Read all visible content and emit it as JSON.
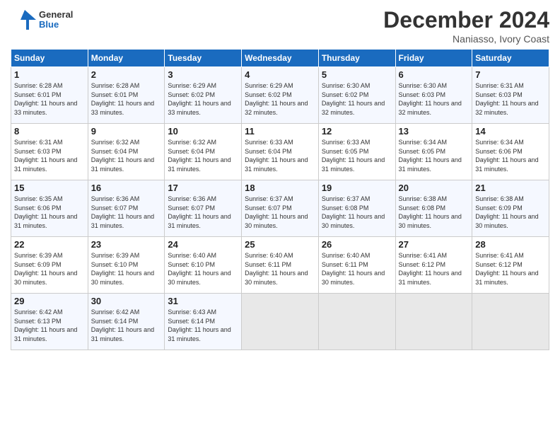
{
  "logo": {
    "text_general": "General",
    "text_blue": "Blue"
  },
  "title": "December 2024",
  "subtitle": "Naniasso, Ivory Coast",
  "headers": [
    "Sunday",
    "Monday",
    "Tuesday",
    "Wednesday",
    "Thursday",
    "Friday",
    "Saturday"
  ],
  "weeks": [
    [
      {
        "day": "1",
        "sunrise": "6:28 AM",
        "sunset": "6:01 PM",
        "daylight": "11 hours and 33 minutes."
      },
      {
        "day": "2",
        "sunrise": "6:28 AM",
        "sunset": "6:01 PM",
        "daylight": "11 hours and 33 minutes."
      },
      {
        "day": "3",
        "sunrise": "6:29 AM",
        "sunset": "6:02 PM",
        "daylight": "11 hours and 33 minutes."
      },
      {
        "day": "4",
        "sunrise": "6:29 AM",
        "sunset": "6:02 PM",
        "daylight": "11 hours and 32 minutes."
      },
      {
        "day": "5",
        "sunrise": "6:30 AM",
        "sunset": "6:02 PM",
        "daylight": "11 hours and 32 minutes."
      },
      {
        "day": "6",
        "sunrise": "6:30 AM",
        "sunset": "6:03 PM",
        "daylight": "11 hours and 32 minutes."
      },
      {
        "day": "7",
        "sunrise": "6:31 AM",
        "sunset": "6:03 PM",
        "daylight": "11 hours and 32 minutes."
      }
    ],
    [
      {
        "day": "8",
        "sunrise": "6:31 AM",
        "sunset": "6:03 PM",
        "daylight": "11 hours and 31 minutes."
      },
      {
        "day": "9",
        "sunrise": "6:32 AM",
        "sunset": "6:04 PM",
        "daylight": "11 hours and 31 minutes."
      },
      {
        "day": "10",
        "sunrise": "6:32 AM",
        "sunset": "6:04 PM",
        "daylight": "11 hours and 31 minutes."
      },
      {
        "day": "11",
        "sunrise": "6:33 AM",
        "sunset": "6:04 PM",
        "daylight": "11 hours and 31 minutes."
      },
      {
        "day": "12",
        "sunrise": "6:33 AM",
        "sunset": "6:05 PM",
        "daylight": "11 hours and 31 minutes."
      },
      {
        "day": "13",
        "sunrise": "6:34 AM",
        "sunset": "6:05 PM",
        "daylight": "11 hours and 31 minutes."
      },
      {
        "day": "14",
        "sunrise": "6:34 AM",
        "sunset": "6:06 PM",
        "daylight": "11 hours and 31 minutes."
      }
    ],
    [
      {
        "day": "15",
        "sunrise": "6:35 AM",
        "sunset": "6:06 PM",
        "daylight": "11 hours and 31 minutes."
      },
      {
        "day": "16",
        "sunrise": "6:36 AM",
        "sunset": "6:07 PM",
        "daylight": "11 hours and 31 minutes."
      },
      {
        "day": "17",
        "sunrise": "6:36 AM",
        "sunset": "6:07 PM",
        "daylight": "11 hours and 31 minutes."
      },
      {
        "day": "18",
        "sunrise": "6:37 AM",
        "sunset": "6:07 PM",
        "daylight": "11 hours and 30 minutes."
      },
      {
        "day": "19",
        "sunrise": "6:37 AM",
        "sunset": "6:08 PM",
        "daylight": "11 hours and 30 minutes."
      },
      {
        "day": "20",
        "sunrise": "6:38 AM",
        "sunset": "6:08 PM",
        "daylight": "11 hours and 30 minutes."
      },
      {
        "day": "21",
        "sunrise": "6:38 AM",
        "sunset": "6:09 PM",
        "daylight": "11 hours and 30 minutes."
      }
    ],
    [
      {
        "day": "22",
        "sunrise": "6:39 AM",
        "sunset": "6:09 PM",
        "daylight": "11 hours and 30 minutes."
      },
      {
        "day": "23",
        "sunrise": "6:39 AM",
        "sunset": "6:10 PM",
        "daylight": "11 hours and 30 minutes."
      },
      {
        "day": "24",
        "sunrise": "6:40 AM",
        "sunset": "6:10 PM",
        "daylight": "11 hours and 30 minutes."
      },
      {
        "day": "25",
        "sunrise": "6:40 AM",
        "sunset": "6:11 PM",
        "daylight": "11 hours and 30 minutes."
      },
      {
        "day": "26",
        "sunrise": "6:40 AM",
        "sunset": "6:11 PM",
        "daylight": "11 hours and 30 minutes."
      },
      {
        "day": "27",
        "sunrise": "6:41 AM",
        "sunset": "6:12 PM",
        "daylight": "11 hours and 31 minutes."
      },
      {
        "day": "28",
        "sunrise": "6:41 AM",
        "sunset": "6:12 PM",
        "daylight": "11 hours and 31 minutes."
      }
    ],
    [
      {
        "day": "29",
        "sunrise": "6:42 AM",
        "sunset": "6:13 PM",
        "daylight": "11 hours and 31 minutes."
      },
      {
        "day": "30",
        "sunrise": "6:42 AM",
        "sunset": "6:14 PM",
        "daylight": "11 hours and 31 minutes."
      },
      {
        "day": "31",
        "sunrise": "6:43 AM",
        "sunset": "6:14 PM",
        "daylight": "11 hours and 31 minutes."
      },
      null,
      null,
      null,
      null
    ]
  ],
  "labels": {
    "sunrise": "Sunrise:",
    "sunset": "Sunset:",
    "daylight": "Daylight:"
  }
}
